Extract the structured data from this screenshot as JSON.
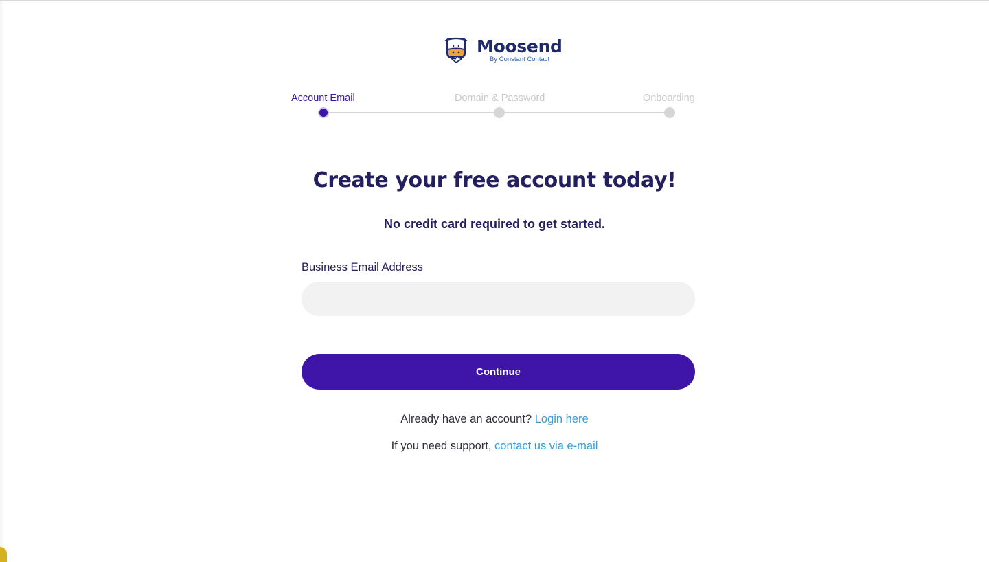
{
  "brand": {
    "name": "Moosend",
    "tagline": "By Constant Contact",
    "colors": {
      "primary": "#3e15a8",
      "heading": "#24205e",
      "link": "#3a9ad9",
      "logo_orange": "#f2a533"
    }
  },
  "stepper": {
    "current_step": 1,
    "steps": [
      {
        "label": "Account Email",
        "state": "active"
      },
      {
        "label": "Domain & Password",
        "state": "inactive"
      },
      {
        "label": "Onboarding",
        "state": "inactive"
      }
    ]
  },
  "main": {
    "title": "Create your free account today!",
    "subtitle": "No credit card required to get started."
  },
  "form": {
    "email_label": "Business Email Address",
    "email_value": "",
    "email_placeholder": "",
    "continue_label": "Continue"
  },
  "footer": {
    "login_prompt": "Already have an account?",
    "login_link": "Login here",
    "support_prompt": "If you need support,",
    "support_link": "contact us via e-mail"
  }
}
